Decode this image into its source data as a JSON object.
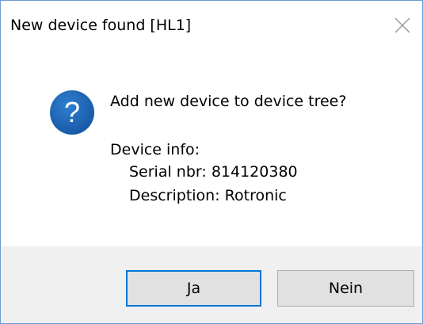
{
  "window": {
    "title": "New device found [HL1]",
    "close_icon": "close-icon"
  },
  "icon": {
    "name": "question-icon",
    "glyph": "?",
    "color": "#1c64b4"
  },
  "message": {
    "question": "Add new device to device tree?",
    "info_heading": "Device info:",
    "serial": "Serial nbr: 814120380",
    "description": "Description: Rotronic"
  },
  "buttons": {
    "yes_label": "Ja",
    "no_label": "Nein"
  },
  "colors": {
    "accent": "#0078d7",
    "window_border": "#6d9ad1",
    "footer_bg": "#f0f0f0",
    "button_bg": "#e1e1e1"
  }
}
